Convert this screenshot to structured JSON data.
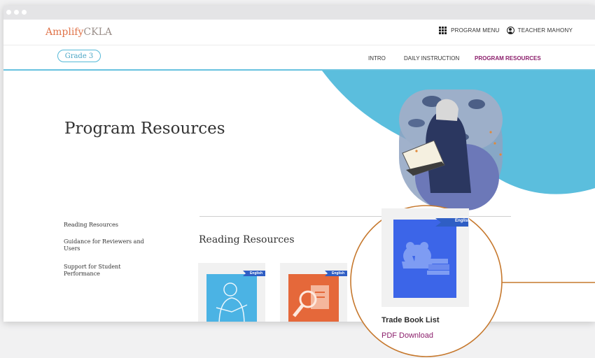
{
  "brand": {
    "part1": "Amplify",
    "part2": "CKLA"
  },
  "topnav": {
    "program_menu": "PROGRAM MENU",
    "user": "TEACHER MAHONY"
  },
  "grade": "Grade 3",
  "tabs": [
    {
      "label": "INTRO",
      "active": false
    },
    {
      "label": "DAILY INSTRUCTION",
      "active": false
    },
    {
      "label": "PROGRAM RESOURCES",
      "active": true
    }
  ],
  "page_title": "Program Resources",
  "sidebar": {
    "items": [
      {
        "label": "Reading Resources"
      },
      {
        "label": "Guidance for Reviewers and Users"
      },
      {
        "label": "Support for Student Performance"
      }
    ]
  },
  "section": {
    "title": "Reading Resources"
  },
  "cards": [
    {
      "tag": "English",
      "cover_color": "#4bb3e4",
      "icon": "child-reading-icon"
    },
    {
      "tag": "English",
      "cover_color": "#e5683a",
      "icon": "magnifier-document-icon"
    }
  ],
  "highlight": {
    "tag": "English",
    "title": "Trade Book List",
    "link": "PDF Download",
    "cover_color": "#3c65e8",
    "ring_color": "#c6782d",
    "icon": "frog-books-icon"
  },
  "colors": {
    "accent_purple": "#8b1e6b",
    "accent_blue": "#55b9d8",
    "brand_orange": "#e0744a"
  }
}
